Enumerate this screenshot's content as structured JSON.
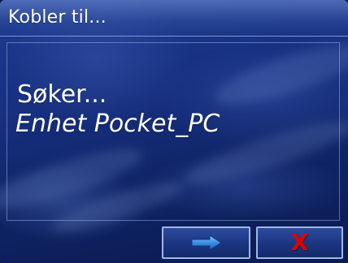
{
  "window": {
    "title": "Kobler til..."
  },
  "content": {
    "status": "Søker...",
    "device": "Enhet Pocket_PC"
  },
  "buttons": {
    "next_icon": "arrow-right-icon",
    "cancel_icon": "close-icon",
    "cancel_glyph": "X"
  },
  "colors": {
    "background": "#173080",
    "text": "#ffffff",
    "arrow": "#3a8ee8",
    "cancel": "#e00000",
    "button_border": "#9fb6e6"
  }
}
